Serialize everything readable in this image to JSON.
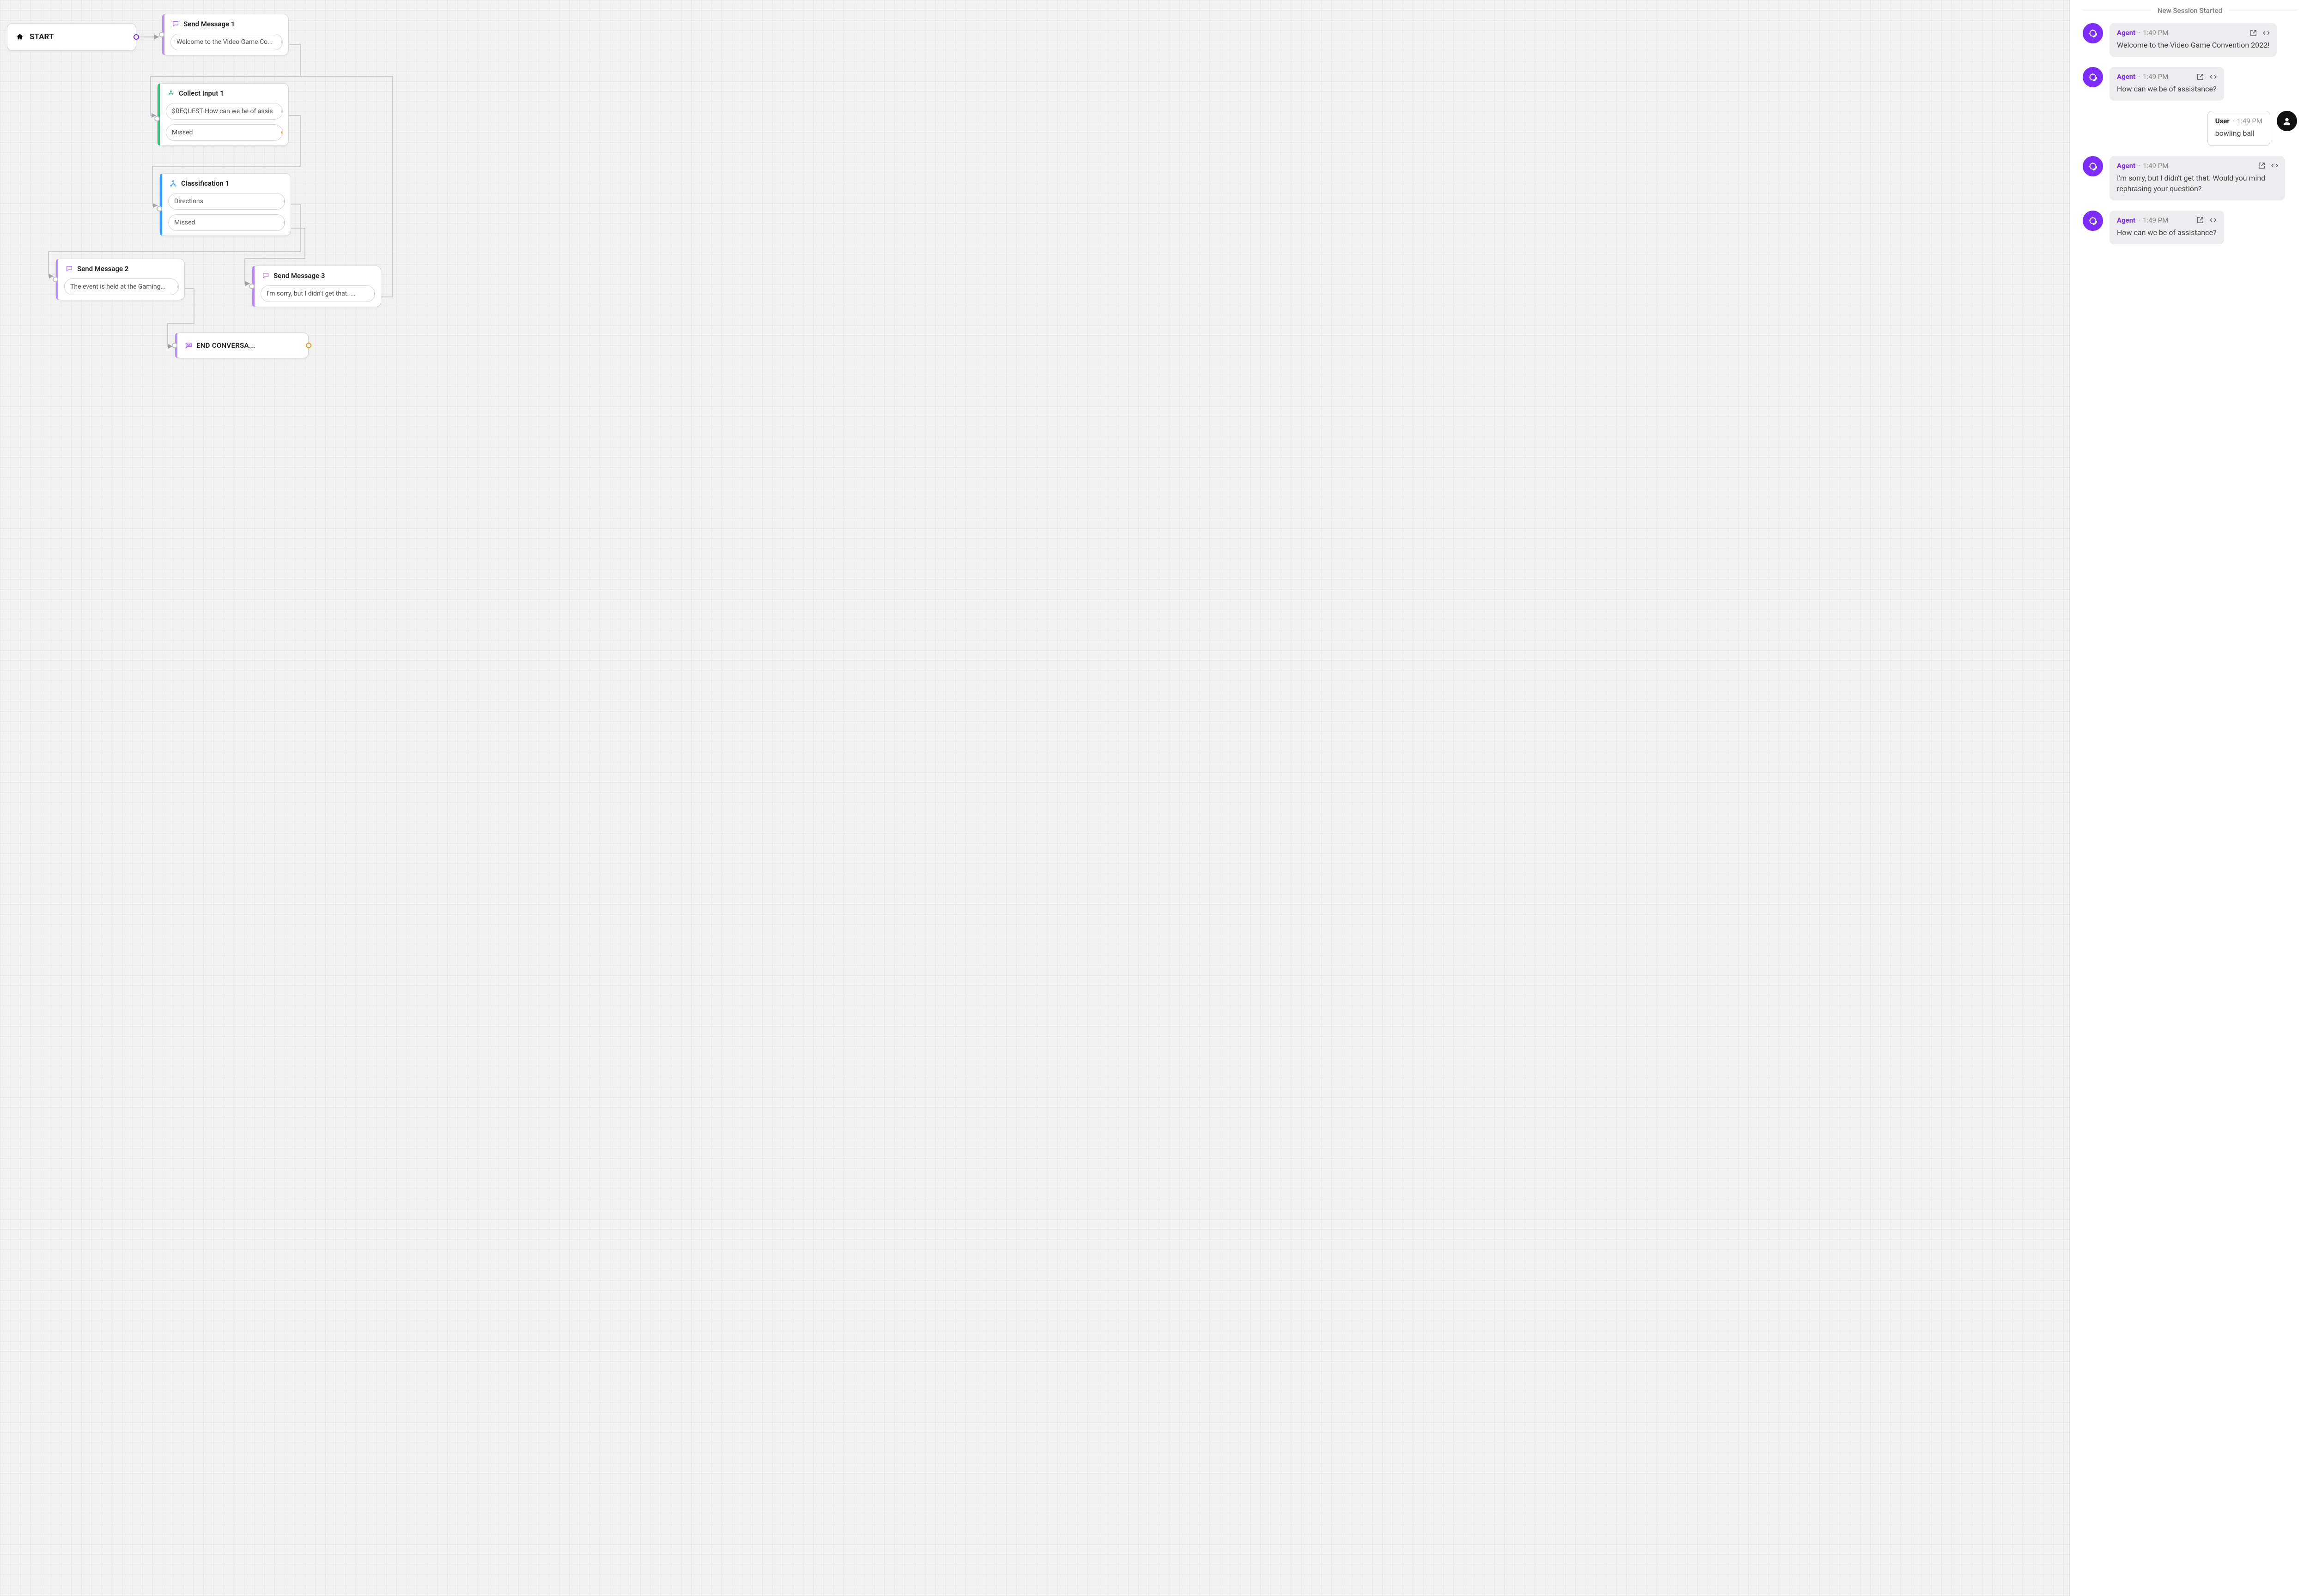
{
  "session_label": "New Session Started",
  "nodes": {
    "start": {
      "label": "START"
    },
    "sm1": {
      "title": "Send Message 1",
      "preview": "Welcome to the Video Game Co..."
    },
    "collect": {
      "title": "Collect Input 1",
      "slot1": "$REQUEST:How can we be of assis",
      "slot2": "Missed"
    },
    "class": {
      "title": "Classification 1",
      "slot1": "Directions",
      "slot2": "Missed"
    },
    "sm2": {
      "title": "Send Message 2",
      "preview": "The event is held at the Gaming..."
    },
    "sm3": {
      "title": "Send Message 3",
      "preview": "I'm sorry, but I didn't get that. ..."
    },
    "end": {
      "title": "END CONVERSA..."
    }
  },
  "chat": [
    {
      "role": "agent",
      "name": "Agent",
      "ts": "1:49 PM",
      "text": "Welcome to the Video Game Convention 2022!"
    },
    {
      "role": "agent",
      "name": "Agent",
      "ts": "1:49 PM",
      "text": "How can we be of assistance?"
    },
    {
      "role": "user",
      "name": "User",
      "ts": "1:49 PM",
      "text": "bowling ball"
    },
    {
      "role": "agent",
      "name": "Agent",
      "ts": "1:49 PM",
      "text": "I'm sorry, but I didn't get that. Would you mind rephrasing your question?"
    },
    {
      "role": "agent",
      "name": "Agent",
      "ts": "1:49 PM",
      "text": "How can we be of assistance?"
    }
  ]
}
